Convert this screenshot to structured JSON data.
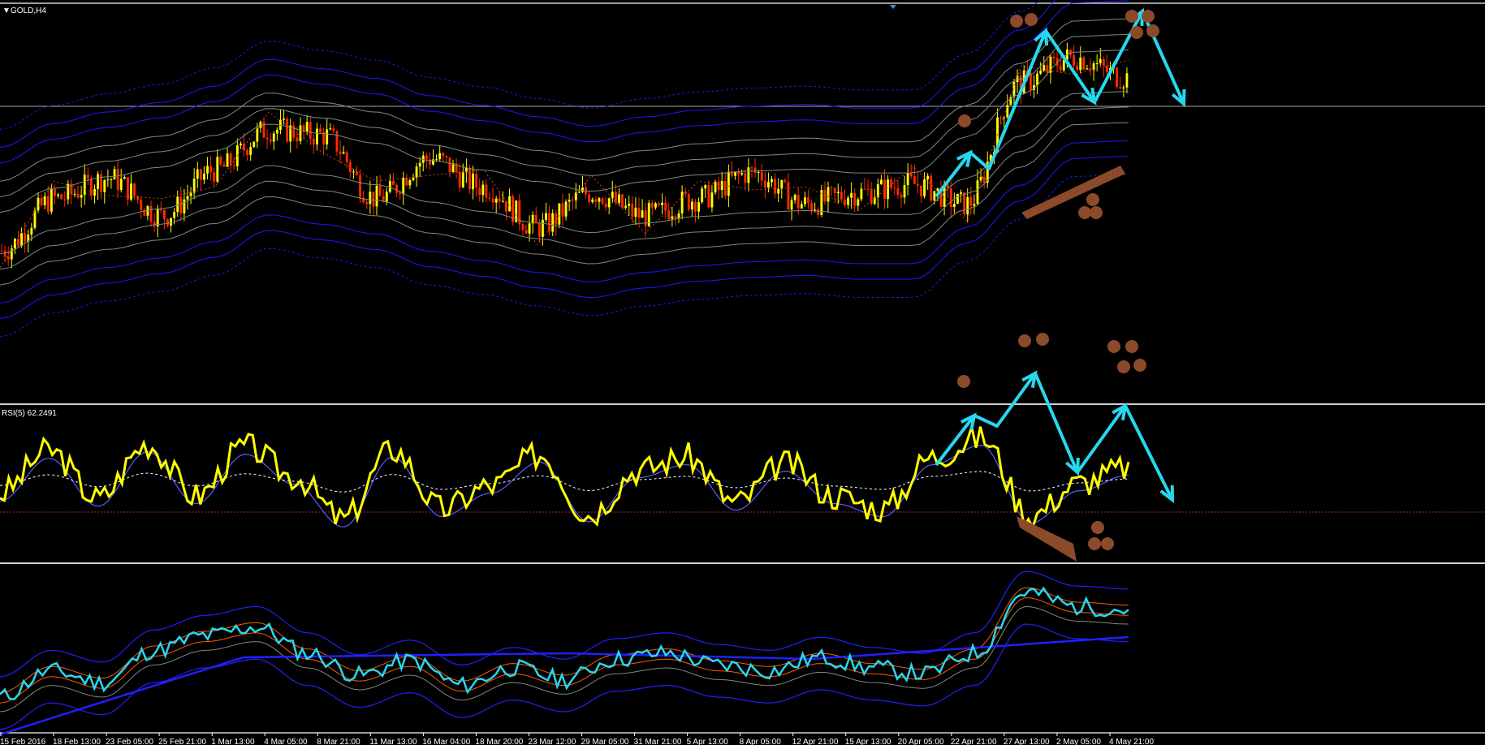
{
  "window": {
    "symbol_label": "GOLD,H4",
    "menu_marker": "▼"
  },
  "panels": {
    "price": {
      "title": "GOLD,H4"
    },
    "rsi": {
      "title": "RSI(5) 62.2491",
      "value": 62.2491,
      "period": 5
    },
    "bottom": {
      "title": ""
    }
  },
  "colors": {
    "background": "#000000",
    "bull_candle": "#ffff00",
    "bear_candle": "#ff2a00",
    "envelope_blue": "#1a1aff",
    "envelope_gray": "#7c8a7c",
    "rsi_line": "#ffff00",
    "rsi_signal": "#5b5bff",
    "rsi_mid": "#ffffff",
    "annotation_arrow": "#27d7f0",
    "annotation_marker": "#8b4a2a",
    "bottom_cyan": "#27d7f0",
    "bottom_orange": "#ff5a00",
    "bottom_blue": "#2020ff"
  },
  "chart_data": [
    {
      "type": "line",
      "panel": "price",
      "title": "GOLD,H4",
      "x": [
        "15 Feb 2016",
        "18 Feb 13:00",
        "23 Feb 05:00",
        "25 Feb 21:00",
        "1 Mar 13:00",
        "4 Mar 05:00",
        "8 Mar 21:00",
        "11 Mar 13:00",
        "16 Mar 04:00",
        "18 Mar 20:00",
        "23 Mar 12:00",
        "29 Mar 05:00",
        "31 Mar 21:00",
        "5 Apr 13:00",
        "8 Apr 05:00",
        "12 Apr 21:00",
        "15 Apr 13:00",
        "20 Apr 05:00",
        "22 Apr 21:00",
        "27 Apr 13:00",
        "2 May 05:00",
        "4 May 21:00"
      ],
      "series": [
        {
          "values": [
            30,
            48,
            55,
            42,
            58,
            72,
            70,
            48,
            62,
            52,
            38,
            50,
            42,
            48,
            57,
            46,
            50,
            53,
            46,
            88,
            97,
            90
          ]
        }
      ],
      "annotations": [
        "up-arrow",
        "peak",
        "down-arrow",
        "peak",
        "down-arrow"
      ]
    },
    {
      "type": "line",
      "panel": "rsi",
      "title": "RSI(5) 62.2491",
      "ylim": [
        0,
        100
      ],
      "series": [
        {
          "values": [
            42,
            75,
            38,
            80,
            40,
            78,
            55,
            22,
            76,
            30,
            48,
            72,
            26,
            60,
            70,
            35,
            65,
            40,
            30,
            70,
            85,
            25,
            50,
            62
          ]
        }
      ]
    },
    {
      "type": "line",
      "panel": "bottom",
      "series": [
        {
          "values": [
            20,
            38,
            30,
            52,
            62,
            68,
            50,
            35,
            45,
            28,
            40,
            32,
            46,
            50,
            42,
            38,
            47,
            40,
            36,
            50,
            92,
            82,
            80
          ]
        }
      ]
    }
  ]
}
